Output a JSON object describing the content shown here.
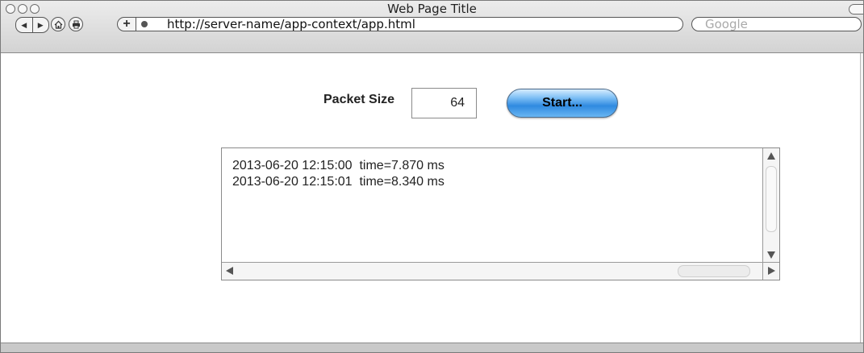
{
  "window": {
    "title": "Web Page Title"
  },
  "toolbar": {
    "address": "http://server-name/app-context/app.html",
    "search_placeholder": "Google",
    "back_icon": "triangle-left",
    "forward_icon": "triangle-right",
    "home_icon": "house",
    "print_icon": "printer",
    "add_icon": "plus"
  },
  "form": {
    "packet_size_label": "Packet Size",
    "packet_size_value": "64",
    "start_label": "Start..."
  },
  "log": {
    "lines": [
      "2013-06-20 12:15:00  time=7.870 ms",
      "2013-06-20 12:15:01  time=8.340 ms"
    ]
  },
  "colors": {
    "start_button": "#2f8ae0",
    "chrome": "#d3d3d3"
  }
}
